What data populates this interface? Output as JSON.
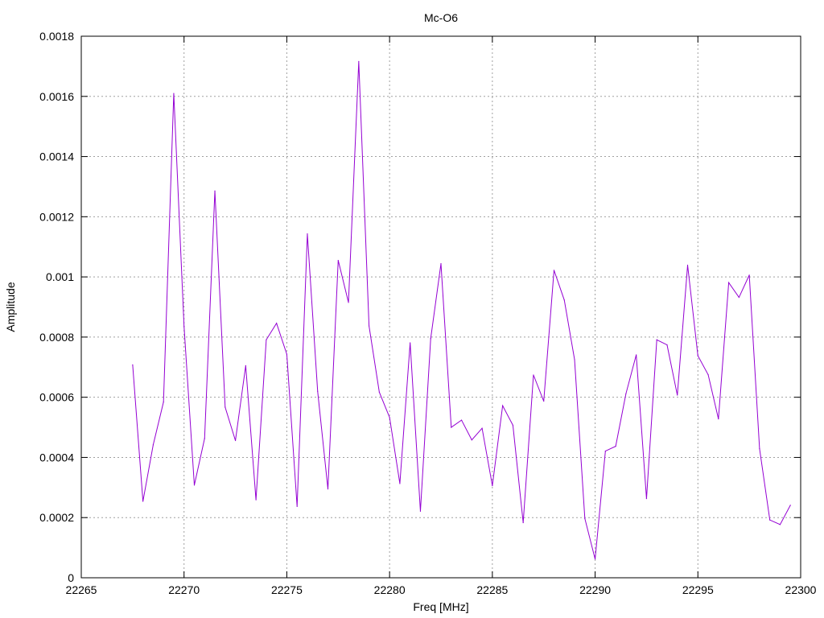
{
  "chart_data": {
    "type": "line",
    "title": "Mc-O6",
    "xlabel": "Freq [MHz]",
    "ylabel": "Amplitude",
    "xlim": [
      22265,
      22300
    ],
    "ylim": [
      0,
      0.0018
    ],
    "x_ticks": [
      22265,
      22270,
      22275,
      22280,
      22285,
      22290,
      22295,
      22300
    ],
    "x_tick_labels": [
      "22265",
      "22270",
      "22275",
      "22280",
      "22285",
      "22290",
      "22295",
      "22300"
    ],
    "y_ticks": [
      0,
      0.0002,
      0.0004,
      0.0006,
      0.0008,
      0.001,
      0.0012,
      0.0014,
      0.0016,
      0.0018
    ],
    "y_tick_labels": [
      "0",
      "0.0002",
      "0.0004",
      "0.0006",
      "0.0008",
      "0.001",
      "0.0012",
      "0.0014",
      "0.0016",
      "0.0018"
    ],
    "grid": true,
    "series": [
      {
        "color": "#9400d3",
        "x": [
          22267.5,
          22268,
          22268.5,
          22269,
          22269.5,
          22270,
          22270.5,
          22271,
          22271.5,
          22272,
          22272.5,
          22273,
          22273.5,
          22274,
          22274.5,
          22275,
          22275.5,
          22276,
          22276.5,
          22277,
          22277.5,
          22278,
          22278.5,
          22279,
          22279.5,
          22280,
          22280.5,
          22281,
          22281.5,
          22282,
          22282.5,
          22283,
          22283.5,
          22284,
          22284.5,
          22285,
          22285.5,
          22286,
          22286.5,
          22287,
          22287.5,
          22288,
          22288.5,
          22289,
          22289.5,
          22290,
          22290.5,
          22291,
          22291.5,
          22292,
          22292.5,
          22293,
          22293.5,
          22294,
          22294.5,
          22295,
          22295.5,
          22296,
          22296.5,
          22297,
          22297.5,
          22298,
          22298.5,
          22299,
          22299.5
        ],
        "y": [
          0.000708,
          0.000254,
          0.000442,
          0.000584,
          0.00161,
          0.000836,
          0.000308,
          0.000463,
          0.001286,
          0.000567,
          0.000456,
          0.000705,
          0.000259,
          0.000791,
          0.000846,
          0.000743,
          0.000237,
          0.001143,
          0.00062,
          0.000295,
          0.001055,
          0.000915,
          0.001716,
          0.000837,
          0.000617,
          0.000533,
          0.000313,
          0.000781,
          0.000221,
          0.000795,
          0.001044,
          0.0005,
          0.000524,
          0.000458,
          0.000497,
          0.000306,
          0.000572,
          0.000507,
          0.000183,
          0.000674,
          0.000587,
          0.001022,
          0.000923,
          0.000725,
          0.000197,
          6.2e-05,
          0.000421,
          0.000437,
          0.000612,
          0.000741,
          0.000263,
          0.000791,
          0.000774,
          0.000607,
          0.001039,
          0.000738,
          0.000675,
          0.000528,
          0.000981,
          0.000932,
          0.001006,
          0.000429,
          0.000192,
          0.000177,
          0.000241
        ]
      }
    ]
  }
}
